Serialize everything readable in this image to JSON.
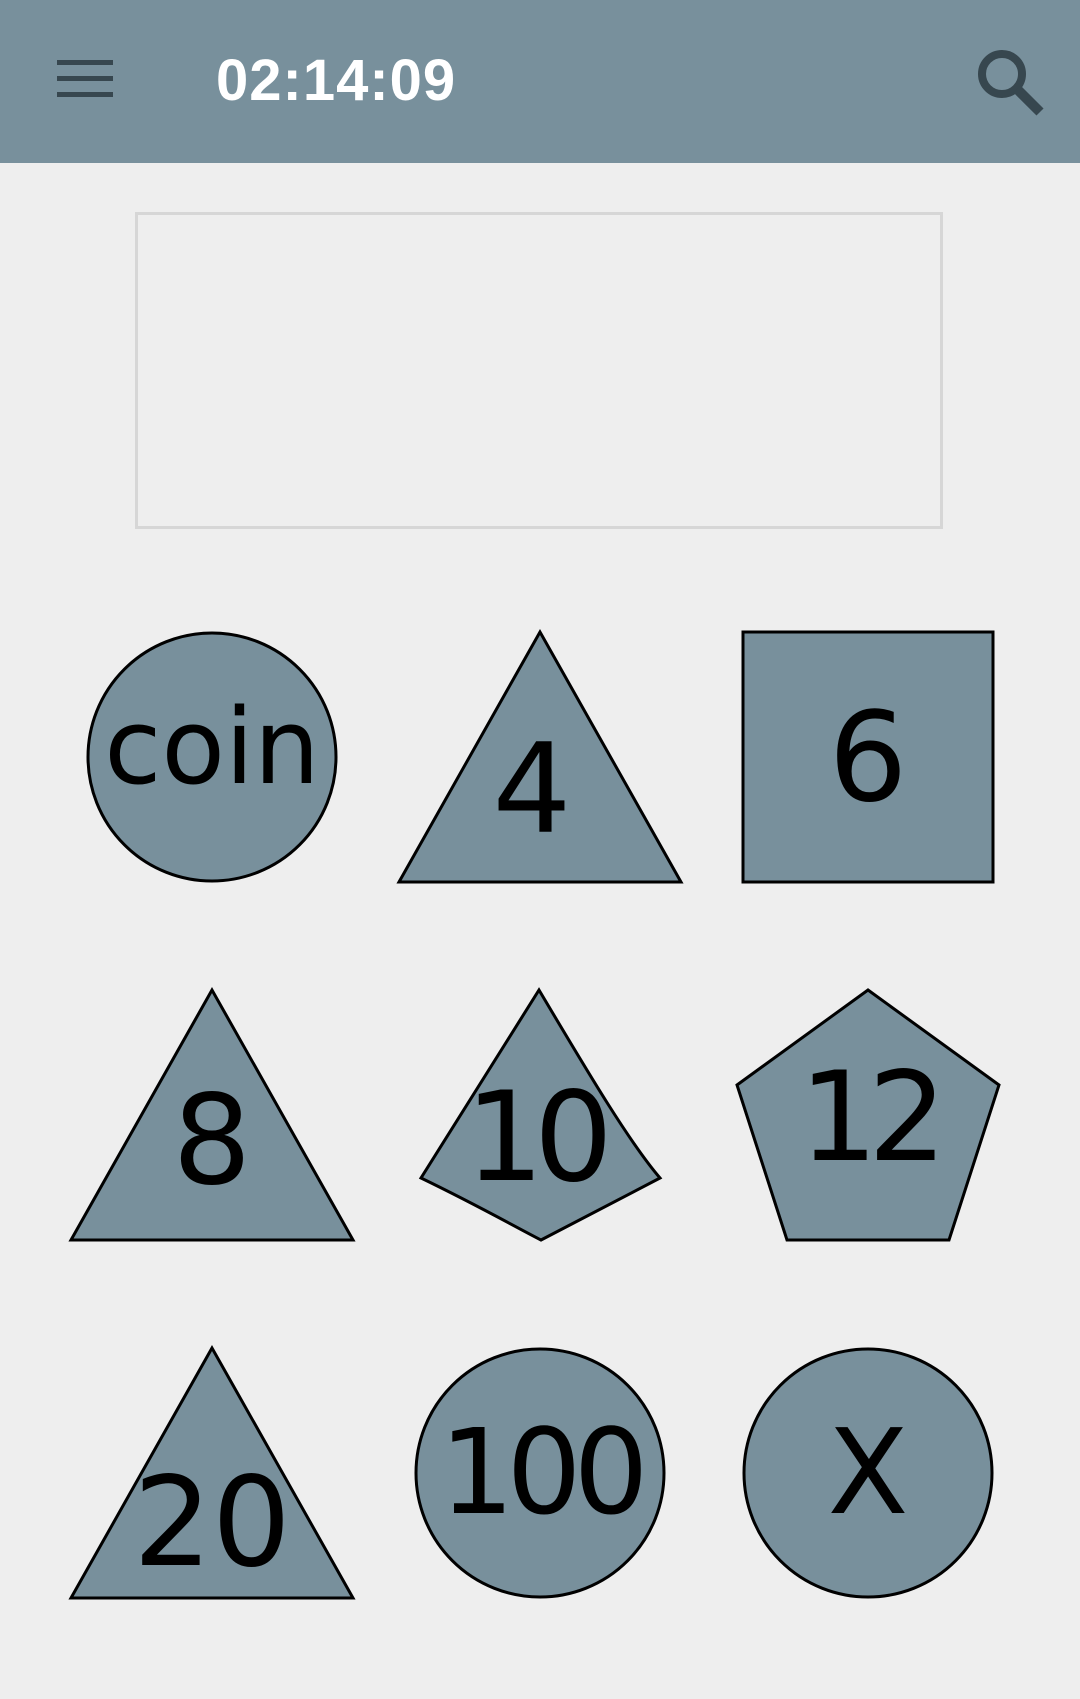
{
  "toolbar": {
    "title": "02:14:09",
    "menu_icon": "hamburger-menu-icon",
    "search_icon": "search-icon"
  },
  "result": {
    "value": ""
  },
  "colors": {
    "toolbar_bg": "#78909c",
    "die_fill": "#78909c",
    "page_bg": "#eeeeee"
  },
  "dice": [
    {
      "label": "coin",
      "shape": "circle"
    },
    {
      "label": "4",
      "shape": "triangle"
    },
    {
      "label": "6",
      "shape": "square"
    },
    {
      "label": "8",
      "shape": "triangle"
    },
    {
      "label": "10",
      "shape": "kite"
    },
    {
      "label": "12",
      "shape": "pentagon"
    },
    {
      "label": "20",
      "shape": "triangle"
    },
    {
      "label": "100",
      "shape": "circle"
    },
    {
      "label": "X",
      "shape": "circle"
    }
  ]
}
